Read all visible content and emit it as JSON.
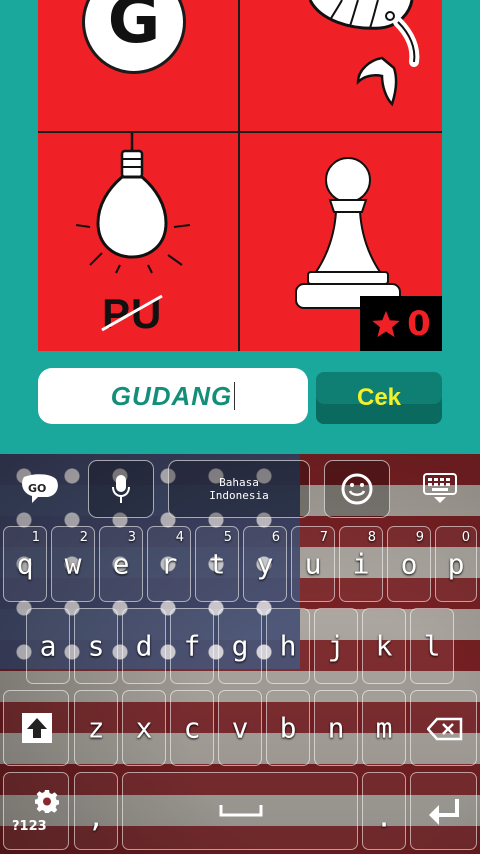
{
  "puzzle": {
    "letter_g": "G",
    "crossed_text": "PU",
    "star_count": "0"
  },
  "answer": {
    "value": "GUDANG",
    "check_label": "Cek"
  },
  "keyboard": {
    "toolbar": {
      "go_label": "GO",
      "language_line1": "Bahasa",
      "language_line2": "Indonesia"
    },
    "row1": [
      {
        "ch": "q",
        "hint": "1"
      },
      {
        "ch": "w",
        "hint": "2"
      },
      {
        "ch": "e",
        "hint": "3"
      },
      {
        "ch": "r",
        "hint": "4"
      },
      {
        "ch": "t",
        "hint": "5"
      },
      {
        "ch": "y",
        "hint": "6"
      },
      {
        "ch": "u",
        "hint": "7"
      },
      {
        "ch": "i",
        "hint": "8"
      },
      {
        "ch": "o",
        "hint": "9"
      },
      {
        "ch": "p",
        "hint": "0"
      }
    ],
    "row2": [
      "a",
      "s",
      "d",
      "f",
      "g",
      "h",
      "j",
      "k",
      "l"
    ],
    "row3": [
      "z",
      "x",
      "c",
      "v",
      "b",
      "n",
      "m"
    ],
    "symbols_label": "?123",
    "comma": ",",
    "period": "."
  },
  "colors": {
    "background": "#1aa89c",
    "puzzle_red": "#ef2126",
    "answer_text": "#138e78",
    "check_button": "#0e7f72",
    "check_text": "#f3f02a"
  }
}
